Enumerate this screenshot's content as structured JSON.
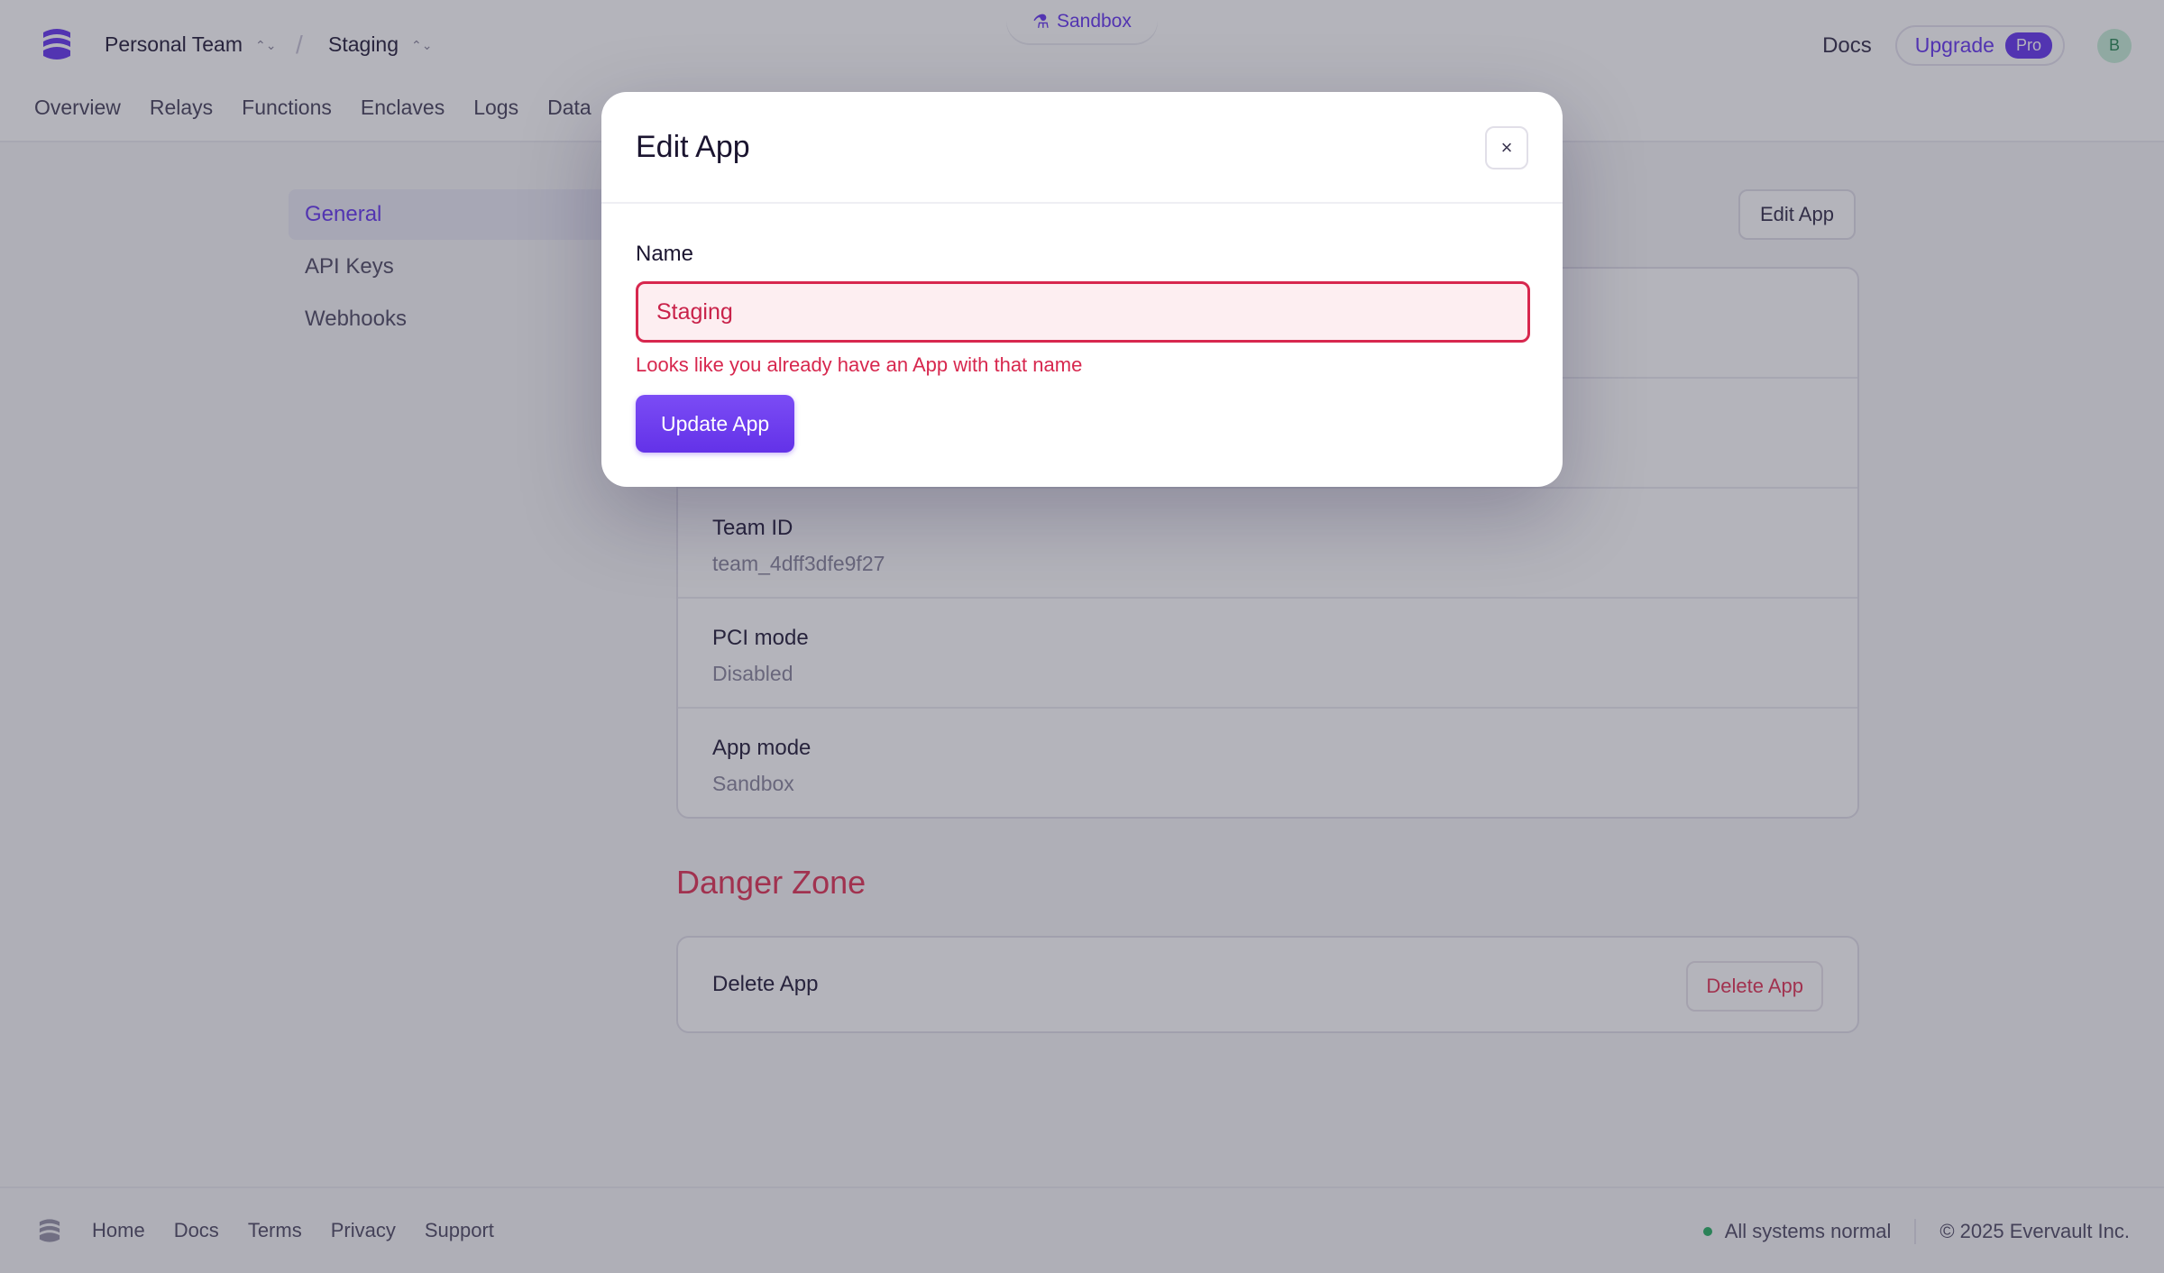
{
  "header": {
    "team_name": "Personal Team",
    "app_name": "Staging",
    "environment_badge": "Sandbox",
    "docs_label": "Docs",
    "upgrade_label": "Upgrade",
    "pro_label": "Pro",
    "avatar_initial": "B"
  },
  "nav": {
    "items": [
      "Overview",
      "Relays",
      "Functions",
      "Enclaves",
      "Logs",
      "Data"
    ]
  },
  "sidebar": {
    "items": [
      {
        "label": "General",
        "active": true
      },
      {
        "label": "API Keys",
        "active": false
      },
      {
        "label": "Webhooks",
        "active": false
      }
    ]
  },
  "main": {
    "edit_app_label": "Edit App",
    "details": [
      {
        "label": "",
        "value": ""
      },
      {
        "label": "",
        "value": ""
      },
      {
        "label": "Team ID",
        "value": "team_4dff3dfe9f27"
      },
      {
        "label": "PCI mode",
        "value": "Disabled"
      },
      {
        "label": "App mode",
        "value": "Sandbox"
      }
    ],
    "danger_zone": {
      "title": "Danger Zone",
      "row_label": "Delete App",
      "button_label": "Delete App"
    }
  },
  "footer": {
    "links": [
      "Home",
      "Docs",
      "Terms",
      "Privacy",
      "Support"
    ],
    "status_text": "All systems normal",
    "copyright": "© 2025 Evervault Inc."
  },
  "modal": {
    "title": "Edit App",
    "close_label": "×",
    "name_label": "Name",
    "name_value": "Staging",
    "error": "Looks like you already have an App with that name",
    "submit_label": "Update App"
  },
  "colors": {
    "accent": "#6b3df0",
    "danger": "#d7274e",
    "status_ok": "#2fb46a"
  }
}
